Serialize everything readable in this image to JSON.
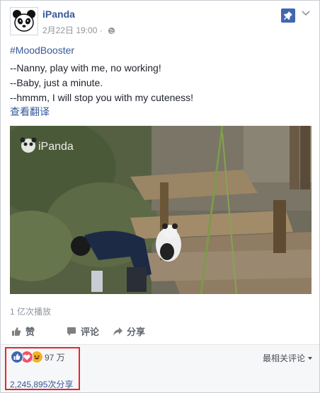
{
  "post": {
    "page_name": "iPanda",
    "timestamp": "2月22日 19:00",
    "dot": "·",
    "hashtag": "#MoodBooster",
    "lines": [
      "--Nanny, play with me, no working!",
      "--Baby, just a minute.",
      "--hmmm, I will stop you with my cuteness!"
    ],
    "translate_link": "查看翻译",
    "video_watermark": "iPanda",
    "views": "1 亿次播放"
  },
  "actions": {
    "like": "赞",
    "comment": "评论",
    "share": "分享"
  },
  "footer": {
    "reaction_count": "97 万",
    "sort_label": "最相关评论",
    "shares": "2,245,895次分享"
  },
  "colors": {
    "link": "#365899",
    "like_blue": "#4267b2",
    "love_red": "#f25268",
    "haha_yellow": "#f7b125",
    "highlight": "#e8262a"
  },
  "icons": [
    "panda-avatar-icon",
    "globe-icon",
    "pin-icon",
    "chevron-down-icon",
    "like-icon",
    "comment-icon",
    "share-icon",
    "like-reaction-icon",
    "love-reaction-icon",
    "haha-reaction-icon"
  ]
}
